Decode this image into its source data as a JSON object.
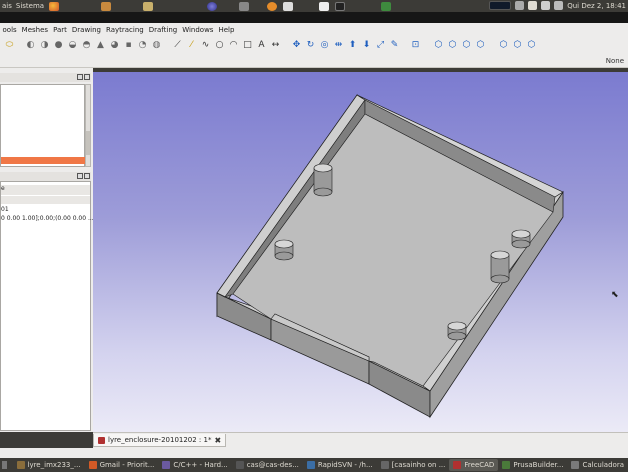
{
  "top_panel": {
    "menus": [
      "ais",
      "Sistema"
    ],
    "clock": "Qui Dez 2, 18:41"
  },
  "menubar": {
    "items": [
      "ools",
      "Meshes",
      "Part",
      "Drawing",
      "Raytracing",
      "Drafting",
      "Windows",
      "Help"
    ]
  },
  "toolbar2": {
    "selection_label": "None"
  },
  "property_panel": {
    "row_prefix": "e",
    "line1": "01",
    "line2": "0 0.00 1.00];0.00;(0.00 0.00 ..."
  },
  "document_tab": {
    "label": "lyre_enclosure-20101202 : 1*"
  },
  "taskbar": {
    "items": [
      {
        "label": "lyre_imx233_...",
        "color": "#8a6d3b"
      },
      {
        "label": "Gmail - Priorit...",
        "color": "#d35a26"
      },
      {
        "label": "C/C++ - Hard...",
        "color": "#6b5aa0"
      },
      {
        "label": "cas@cas-des...",
        "color": "#555555"
      },
      {
        "label": "RapidSVN - /h...",
        "color": "#3b6ea5"
      },
      {
        "label": "[casainho on ...",
        "color": "#666666"
      },
      {
        "label": "FreeCAD",
        "color": "#b03030"
      },
      {
        "label": "PrusaBuilder...",
        "color": "#4a7a3a"
      },
      {
        "label": "Calculadora",
        "color": "#7a7a7a"
      }
    ],
    "active": "FreeCAD"
  },
  "colors": {
    "panel_bg": "#3c3b37",
    "window_bg": "#edeceb",
    "tree_highlight": "#f07746",
    "view_top": "#7b7bd0",
    "view_bottom": "#ecebf7"
  }
}
